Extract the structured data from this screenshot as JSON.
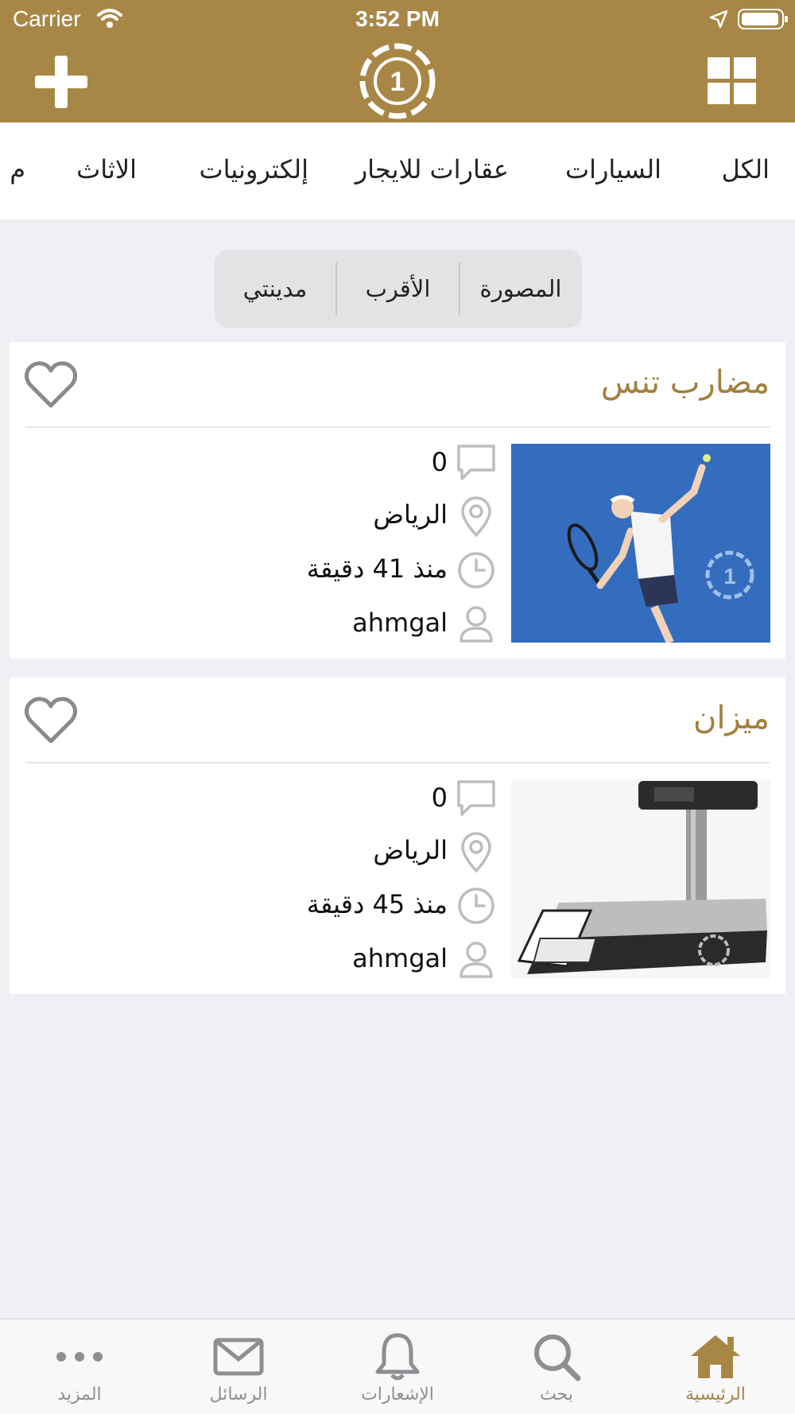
{
  "status_bar": {
    "carrier": "Carrier",
    "time": "3:52 PM"
  },
  "header": {
    "logo_text": "1"
  },
  "categories": [
    "الكل",
    "السيارات",
    "عقارات للايجار",
    "إلكترونيات",
    "الاثاث",
    "م"
  ],
  "filters": {
    "photographed": "المصورة",
    "nearest": "الأقرب",
    "my_city": "مدينتي"
  },
  "listings": [
    {
      "title": "مضارب تنس",
      "comments": "0",
      "city": "الرياض",
      "time_ago": "منذ 41 دقيقة",
      "user": "ahmgal",
      "image": "tennis-player-photo"
    },
    {
      "title": "ميزان",
      "comments": "0",
      "city": "الرياض",
      "time_ago": "منذ 45 دقيقة",
      "user": "ahmgal",
      "image": "digital-scale-photo"
    }
  ],
  "tabs": [
    {
      "label": "الرئيسية",
      "icon": "home-icon",
      "active": true
    },
    {
      "label": "بحث",
      "icon": "search-icon",
      "active": false
    },
    {
      "label": "الإشعارات",
      "icon": "bell-icon",
      "active": false
    },
    {
      "label": "الرسائل",
      "icon": "envelope-icon",
      "active": false
    },
    {
      "label": "المزيد",
      "icon": "more-dots-icon",
      "active": false
    }
  ],
  "colors": {
    "brand": "#a88746",
    "title_gold": "#a1803e",
    "background": "#efeff4",
    "icon_gray": "#bdbdbd"
  }
}
